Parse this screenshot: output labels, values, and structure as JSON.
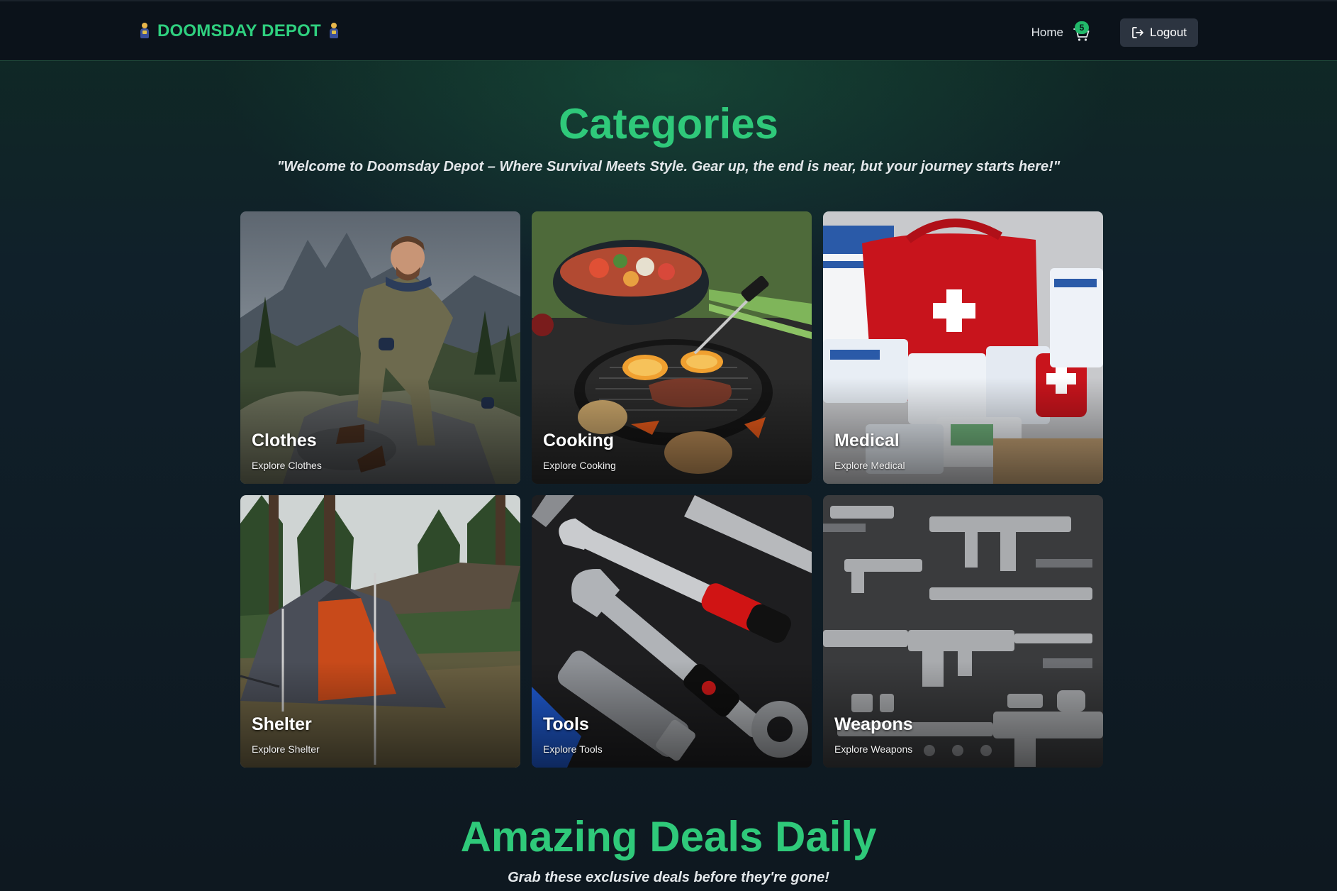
{
  "nav": {
    "brand": "DOOMSDAY DEPOT",
    "brand_icon": "survivor-emoji-icon",
    "home_label": "Home",
    "cart_count": "5",
    "cart_icon": "cart-icon",
    "logout_label": "Logout",
    "logout_icon": "logout-icon"
  },
  "categories": {
    "title": "Categories",
    "tagline": "\"Welcome to Doomsday Depot – Where Survival Meets Style. Gear up, the end is near, but your journey starts here!\"",
    "items": [
      {
        "name": "Clothes",
        "sub": "Explore Clothes",
        "image": "man sitting on rock in mountains wearing outdoor jacket"
      },
      {
        "name": "Cooking",
        "sub": "Explore Cooking",
        "image": "grill pan with steak and orange slices over campfire"
      },
      {
        "name": "Medical",
        "sub": "Explore Medical",
        "image": "red first aid kit with bandage packs"
      },
      {
        "name": "Shelter",
        "sub": "Explore Shelter",
        "image": "grey tent with tarp in forest clearing"
      },
      {
        "name": "Tools",
        "sub": "Explore Tools",
        "image": "wrenches and red-handled tools on black surface"
      },
      {
        "name": "Weapons",
        "sub": "Explore Weapons",
        "image": "collection of rifles and gun parts on grey surface"
      }
    ]
  },
  "deals": {
    "title": "Amazing Deals Daily",
    "tagline": "Grab these exclusive deals before they're gone!"
  },
  "colors": {
    "accent": "#2fc97a",
    "background": "#101820",
    "navbar": "#0b121a",
    "badge": "#22b86a",
    "button": "#2c3440"
  }
}
